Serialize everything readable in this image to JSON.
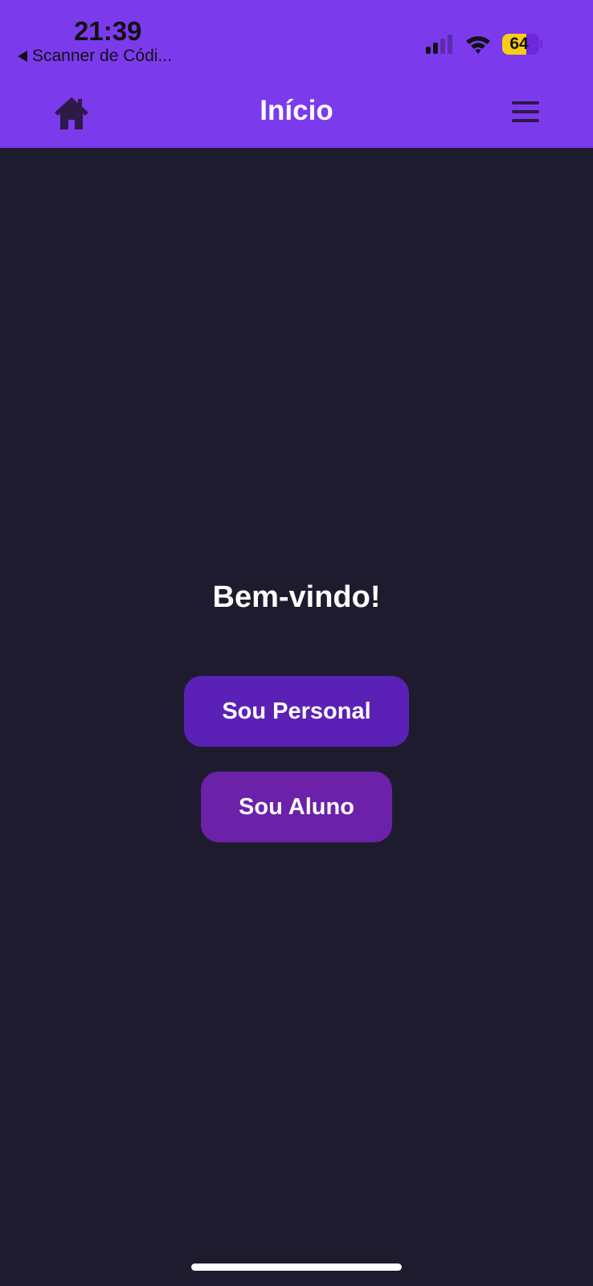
{
  "status_bar": {
    "time": "21:39",
    "back_app_label": "Scanner de Códi...",
    "battery_level": "64",
    "signal_bars_active": 2,
    "signal_bars_total": 4
  },
  "header": {
    "title": "Início",
    "home_icon": "home-icon",
    "menu_icon": "hamburger-menu-icon"
  },
  "main": {
    "welcome_text": "Bem-vindo!",
    "personal_button_label": "Sou Personal",
    "aluno_button_label": "Sou Aluno"
  },
  "colors": {
    "header_bg": "#7c3aed",
    "page_bg": "#1f1b2e",
    "personal_button_bg": "#5b21b6",
    "aluno_button_bg": "#6b21a8",
    "battery_fill": "#facc15",
    "icon_dark": "#2e1a47"
  }
}
